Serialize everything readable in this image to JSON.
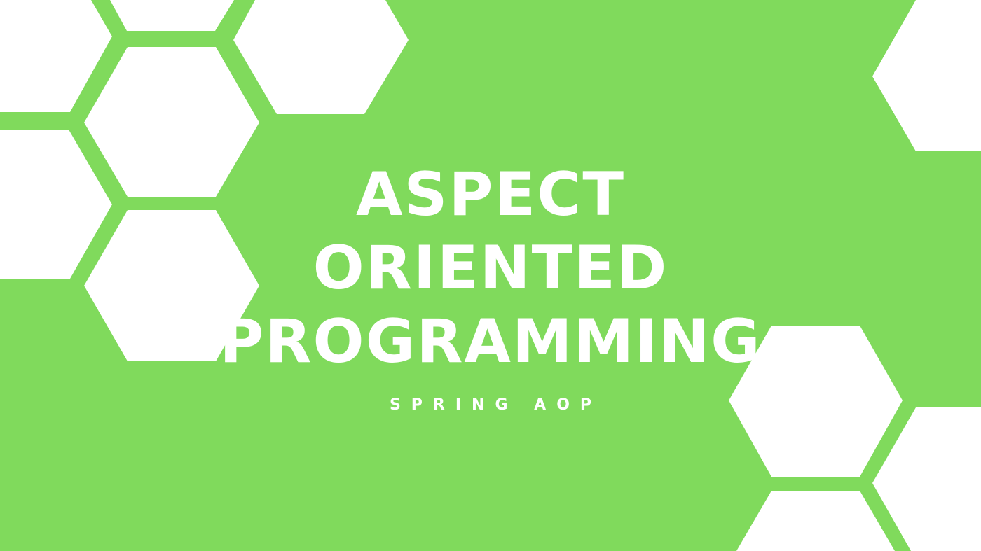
{
  "banner": {
    "title_lines": [
      "ASPECT",
      "ORIENTED",
      "PROGRAMMING"
    ],
    "subtitle": "SPRING AOP",
    "colors": {
      "background": "#80da5c",
      "shape_fill": "#ffffff"
    }
  }
}
